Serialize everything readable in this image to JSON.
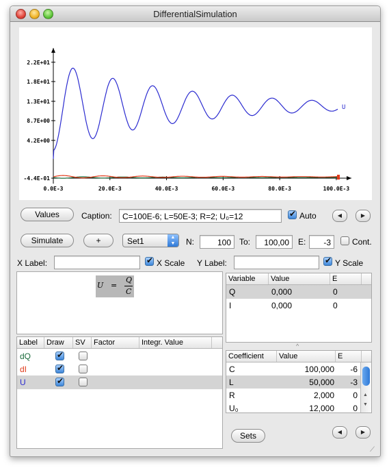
{
  "window": {
    "title": "DifferentialSimulation"
  },
  "chart_data": {
    "type": "line",
    "x_range": [
      0.0,
      0.1
    ],
    "y_range": [
      -4.4,
      24.0
    ],
    "y_ticks": [
      "2.2E+01",
      "1.8E+01",
      "1.3E+01",
      "8.7E+00",
      "4.2E+00",
      "-4.4E-01"
    ],
    "x_ticks": [
      "0.0E-3",
      "20.0E-3",
      "40.0E-3",
      "60.0E-3",
      "80.0E-3",
      "100.0E-3"
    ],
    "series": [
      {
        "label": "U",
        "color": "#2b2bd0",
        "type": "damped-oscillation",
        "start": 0,
        "steady": 12,
        "peak_first": 22.1,
        "period_s": 0.014,
        "decay_s": 0.045
      },
      {
        "label": "dQ",
        "color": "#1a6b3c",
        "approx_value": -0.1
      },
      {
        "label": "dI",
        "color": "#e03a1a",
        "approx_value": 0.0
      }
    ],
    "end_label": "U"
  },
  "toolbar": {
    "values_button": "Values",
    "caption_label": "Caption:",
    "caption_value": "C=100E-6; L=50E-3; R=2; U₀=12",
    "auto_label": "Auto",
    "auto_checked": true,
    "simulate_button": "Simulate",
    "plus_button": "+",
    "set_select": "Set1",
    "n_label": "N:",
    "n_value": "100",
    "to_label": "To:",
    "to_value": "100,00",
    "e_label": "E:",
    "e_value": "-3",
    "cont_label": "Cont.",
    "cont_checked": false,
    "xlabel_label": "X Label:",
    "xlabel_value": "",
    "xscale_label": "X Scale",
    "xscale_checked": true,
    "ylabel_label": "Y Label:",
    "ylabel_value": "",
    "yscale_label": "Y Scale",
    "yscale_checked": true
  },
  "formula": {
    "lhs": "U",
    "eq": "=",
    "num": "Q",
    "den": "C"
  },
  "series_table": {
    "headers": [
      "Label",
      "Draw",
      "SV",
      "Factor",
      "Integr. Value"
    ],
    "rows": [
      {
        "label": "dQ",
        "color": "#1a6b3c",
        "draw": true,
        "sv": false
      },
      {
        "label": "dI",
        "color": "#e03a1a",
        "draw": true,
        "sv": false
      },
      {
        "label": "U",
        "color": "#2b2bd0",
        "draw": true,
        "sv": false
      }
    ]
  },
  "variables_table": {
    "headers": [
      "Variable",
      "Value",
      "E"
    ],
    "rows": [
      {
        "name": "Q",
        "value": "0,000",
        "e": "0"
      },
      {
        "name": "I",
        "value": "0,000",
        "e": "0"
      }
    ]
  },
  "coefficients_table": {
    "headers": [
      "Coefficient",
      "Value",
      "E"
    ],
    "rows": [
      {
        "name": "C",
        "value": "100,000",
        "e": "-6"
      },
      {
        "name": "L",
        "value": "50,000",
        "e": "-3"
      },
      {
        "name": "R",
        "value": "2,000",
        "e": "0"
      },
      {
        "name": "U₀",
        "value": "12,000",
        "e": "0"
      }
    ]
  },
  "sets_button": "Sets"
}
